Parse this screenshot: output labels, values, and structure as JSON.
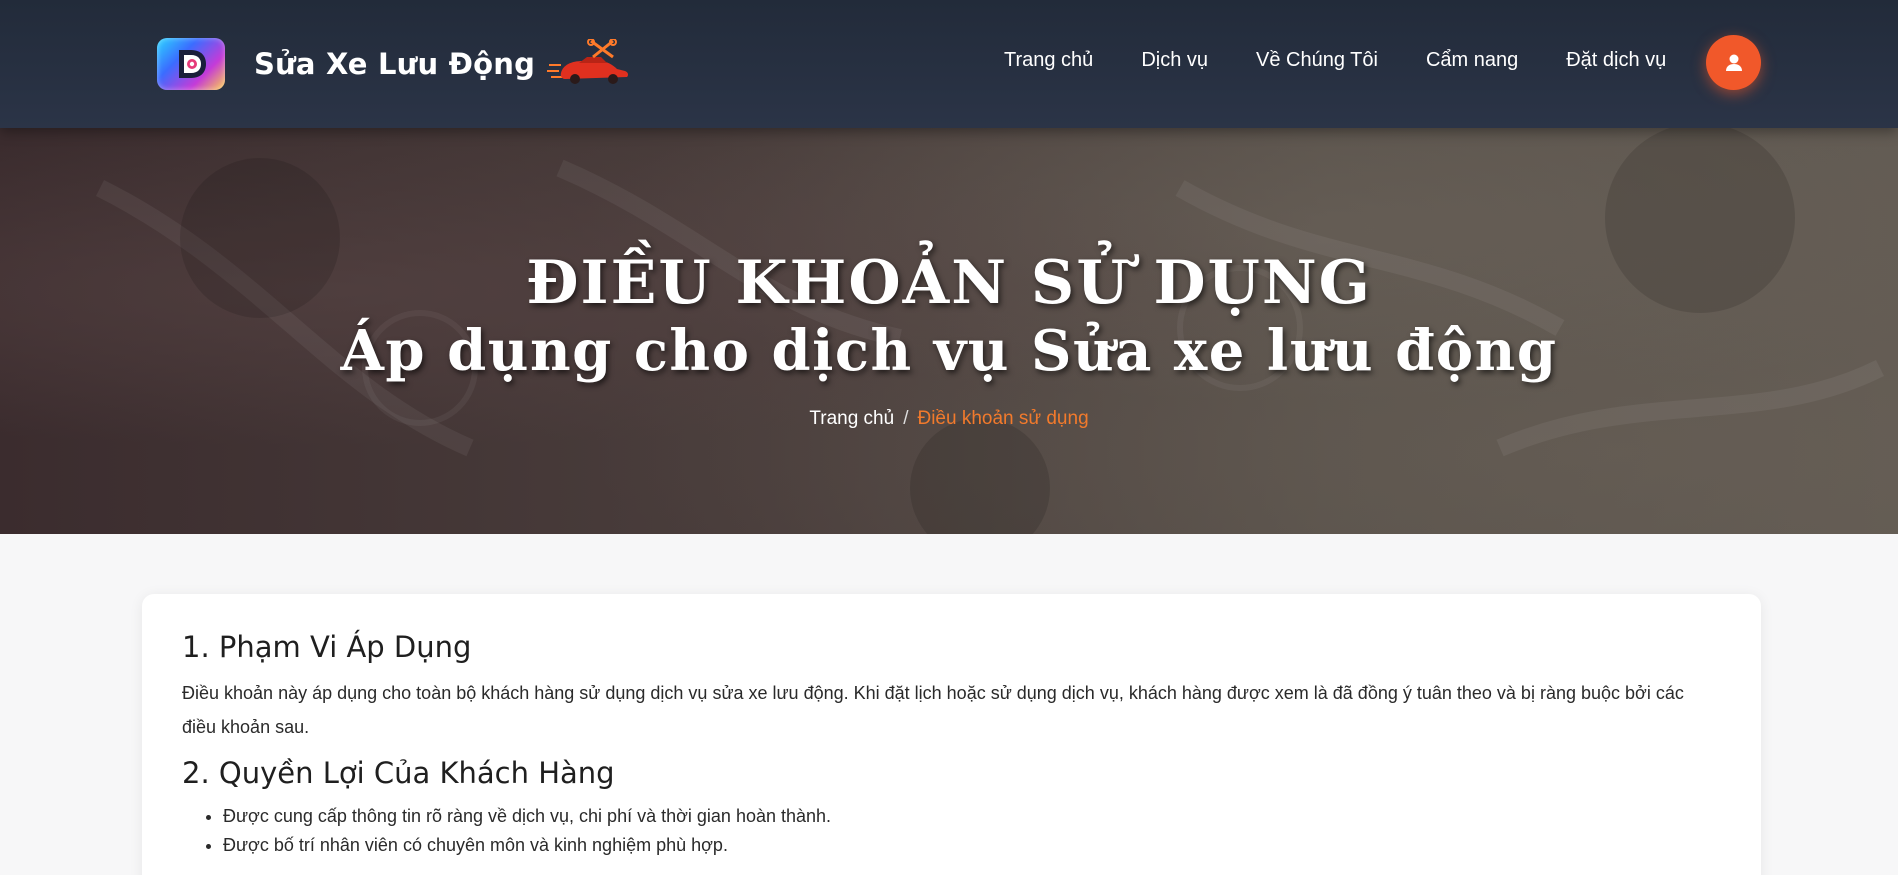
{
  "header": {
    "brand_name": "Sửa Xe Lưu Động",
    "logo_icon": "d-logo-icon",
    "brand_decoration_icon": "car-wrench-icon",
    "nav": [
      {
        "label": "Trang chủ"
      },
      {
        "label": "Dịch vụ"
      },
      {
        "label": "Về Chúng Tôi"
      },
      {
        "label": "Cẩm nang"
      },
      {
        "label": "Đặt dịch vụ"
      }
    ],
    "user_icon": "user-icon",
    "accent_color": "#f1582a"
  },
  "hero": {
    "title_line1": "ĐIỀU KHOẢN SỬ DỤNG",
    "title_line2": "Áp dụng cho dịch vụ Sửa xe lưu động",
    "breadcrumb": {
      "home": "Trang chủ",
      "separator": "/",
      "current": "Điều khoản sử dụng"
    },
    "breadcrumb_active_color": "#f27a2c"
  },
  "content": {
    "sections": [
      {
        "heading": "1. Phạm Vi Áp Dụng",
        "paragraph": "Điều khoản này áp dụng cho toàn bộ khách hàng sử dụng dịch vụ sửa xe lưu động. Khi đặt lịch hoặc sử dụng dịch vụ, khách hàng được xem là đã đồng ý tuân theo và bị ràng buộc bởi các điều khoản sau."
      },
      {
        "heading": "2. Quyền Lợi Của Khách Hàng",
        "items": [
          "Được cung cấp thông tin rõ ràng về dịch vụ, chi phí và thời gian hoàn thành.",
          "Được bố trí nhân viên có chuyên môn và kinh nghiệm phù hợp."
        ]
      }
    ]
  }
}
